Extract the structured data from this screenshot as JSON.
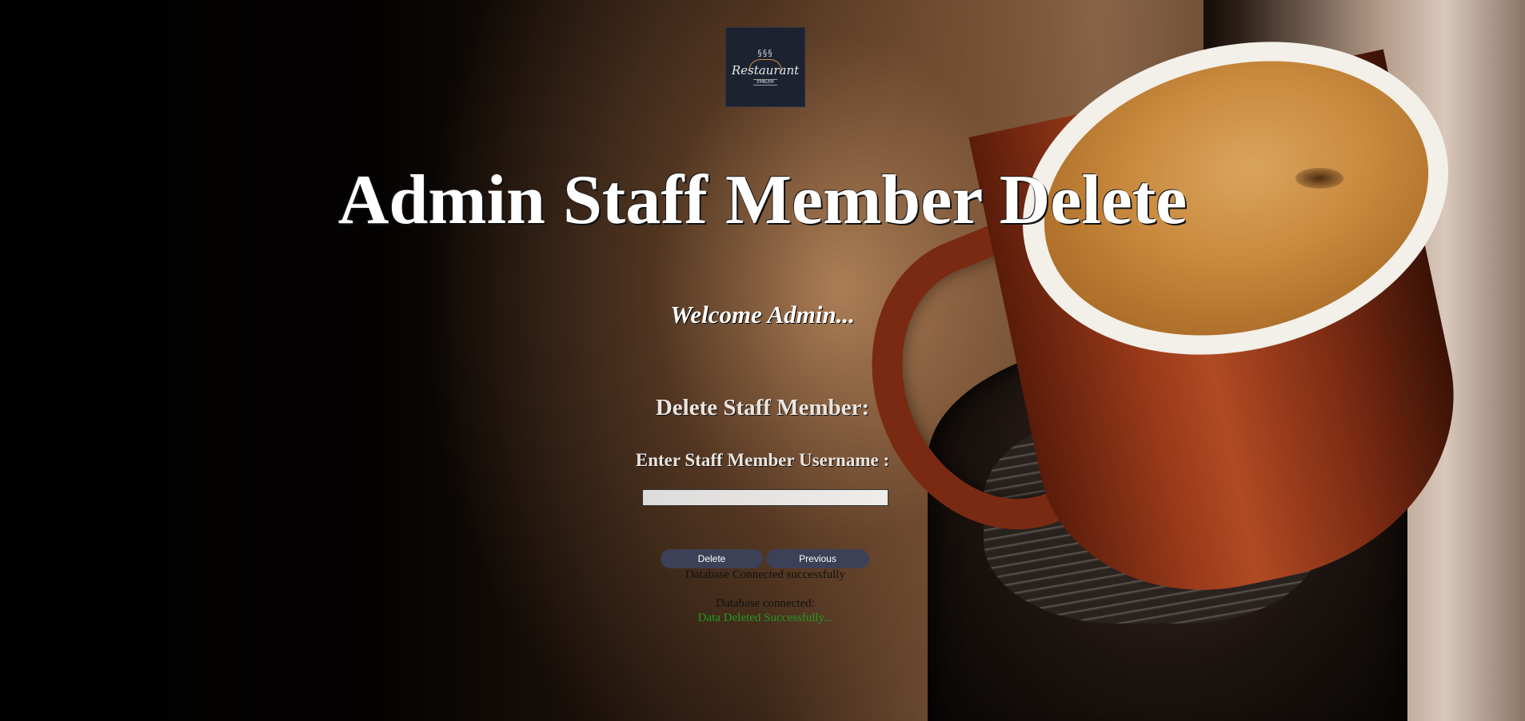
{
  "logo": {
    "script_text": "Restaurant",
    "sub_text": "EMBLEM"
  },
  "header": {
    "title": "Admin Staff Member Delete",
    "welcome": "Welcome Admin..."
  },
  "form": {
    "heading": "Delete Staff Member:",
    "username_label": "Enter Staff Member Username :",
    "username_value": "",
    "delete_label": "Delete",
    "previous_label": "Previous"
  },
  "status": {
    "connected": "Database Connected successfully",
    "db_connected": "Database connected:",
    "deleted": "Data Deleted Successfully..."
  },
  "colors": {
    "button_bg": "#3c4157",
    "success_text": "#1f9a22"
  }
}
